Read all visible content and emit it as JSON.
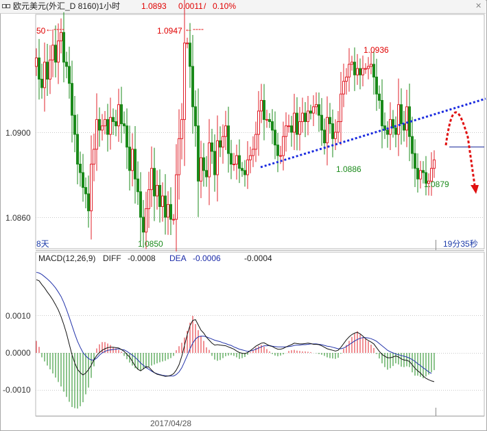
{
  "header": {
    "title": "欧元美元(外汇_D 8160)1小时",
    "price": "1.0893",
    "change": "0.0011",
    "change_sep": "/",
    "change_pct": "0.10%"
  },
  "price_panel": {
    "y_ticks": [
      "1.0900",
      "1.0860"
    ],
    "left_tag": "8天",
    "right_tag": "19分35秒",
    "annotations": {
      "cut_high": "50",
      "high1": "1.0947",
      "high2": "1.0936",
      "low1": "1.0850",
      "low2": "1.0886",
      "low3": "1.0879"
    }
  },
  "macd_panel": {
    "name": "MACD(12,26,9)",
    "diff_label": "DIFF",
    "diff_value": "-0.0008",
    "dea_label": "DEA",
    "dea_value": "-0.0006",
    "macd_value": "-0.0004",
    "y_ticks": [
      "0.0010",
      "0.0000",
      "-0.0010"
    ]
  },
  "x_axis": {
    "date_label": "2017/04/28"
  },
  "colors": {
    "up": "#e0202a",
    "down": "#1a8a1a",
    "diff_line": "#111111",
    "dea_line": "#2233aa",
    "trend_line": "#1a2adf",
    "forecast_arrow": "#e01010"
  },
  "chart_data": [
    {
      "type": "candlestick",
      "title": "欧元美元(外汇_D 8160)1小时",
      "y_ticks": [
        1.09,
        1.086
      ],
      "ylim": [
        1.0842,
        1.0966
      ],
      "key_levels": [
        {
          "label": "1.0947",
          "value": 1.0947
        },
        {
          "label": "1.0936",
          "value": 1.0936
        },
        {
          "label": "1.0850",
          "value": 1.085
        },
        {
          "label": "1.0886",
          "value": 1.0886
        },
        {
          "label": "1.0879",
          "value": 1.0879
        }
      ],
      "series": {
        "close": [
          1.0935,
          1.0925,
          1.0921,
          1.0933,
          1.0925,
          1.0934,
          1.0941,
          1.0933,
          1.0943,
          1.0947,
          1.0933,
          1.0931,
          1.0923,
          1.0908,
          1.0899,
          1.0885,
          1.0881,
          1.0874,
          1.0871,
          1.0863,
          1.0885,
          1.0892,
          1.0906,
          1.0901,
          1.0903,
          1.0906,
          1.0899,
          1.0907,
          1.0905,
          1.0903,
          1.0913,
          1.0904,
          1.0903,
          1.0893,
          1.0882,
          1.0892,
          1.0878,
          1.0872,
          1.086,
          1.0853,
          1.0864,
          1.0873,
          1.0883,
          1.087,
          1.0875,
          1.0865,
          1.087,
          1.086,
          1.0866,
          1.0859,
          1.0859,
          1.088,
          1.0897,
          1.0906,
          1.0942,
          1.0942,
          1.0931,
          1.0912,
          1.0903,
          1.0877,
          1.0888,
          1.0882,
          1.0879,
          1.0895,
          1.0891,
          1.088,
          1.0896,
          1.0893,
          1.0898,
          1.0903,
          1.089,
          1.0885,
          1.0885,
          1.0889,
          1.0883,
          1.0882,
          1.088,
          1.0887,
          1.0889,
          1.0892,
          1.0899,
          1.091,
          1.0915,
          1.0906,
          1.0906,
          1.0905,
          1.0901,
          1.0894,
          1.0889,
          1.0889,
          1.0898,
          1.0903,
          1.0903,
          1.09,
          1.0909,
          1.0899,
          1.0905,
          1.0909,
          1.0905,
          1.091,
          1.0909,
          1.0912,
          1.0913,
          1.0908,
          1.0901,
          1.0895,
          1.0907,
          1.0904,
          1.0897,
          1.09,
          1.0905,
          1.0918,
          1.0924,
          1.0926,
          1.0932,
          1.0933,
          1.0927,
          1.093,
          1.0927,
          1.093,
          1.093,
          1.0931,
          1.0932,
          1.0926,
          1.0918,
          1.0915,
          1.0903,
          1.0901,
          1.0899,
          1.0906,
          1.0902,
          1.0899,
          1.0913,
          1.0904,
          1.0901,
          1.0912,
          1.0898,
          1.089,
          1.0883,
          1.0878,
          1.0882,
          1.0881,
          1.0876,
          1.0877,
          1.0883,
          1.0887
        ]
      }
    },
    {
      "type": "bar",
      "title": "MACD(12,26,9)",
      "y_ticks": [
        0.001,
        0.0,
        -0.001
      ],
      "ylim": [
        -0.0016,
        0.0024
      ],
      "series": [
        {
          "name": "DIFF",
          "values": [
            0.00196,
            0.00193,
            0.00183,
            0.00174,
            0.00163,
            0.00153,
            0.00142,
            0.00129,
            0.00115,
            0.00097,
            0.00076,
            0.00052,
            0.00023,
            -5e-05,
            -0.00027,
            -0.00044,
            -0.00053,
            -0.00059,
            -0.00054,
            -0.00045,
            -0.00033,
            -0.00018,
            -7e-05,
            1e-05,
            7e-05,
            0.00011,
            0.00014,
            0.00015,
            0.00015,
            0.00014,
            0.00013,
            9e-05,
            4e-05,
            -4e-05,
            -0.00011,
            -0.00023,
            -0.00035,
            -0.00044,
            -0.00048,
            -0.00043,
            -0.00037,
            -0.00038,
            -0.00046,
            -0.00053,
            -0.00057,
            -0.00059,
            -0.00061,
            -0.00063,
            -0.00062,
            -0.0006,
            -0.00056,
            -0.00046,
            -0.00032,
            -9e-05,
            0.0002,
            0.00049,
            0.00073,
            0.00087,
            0.00089,
            0.00075,
            0.00061,
            0.00053,
            0.00042,
            0.00034,
            0.00026,
            0.00021,
            0.00022,
            0.00021,
            0.0002,
            0.00019,
            0.00016,
            0.00013,
            0.0001,
            5e-05,
            1e-05,
            -1e-05,
            -2e-05,
            1e-05,
            6e-05,
            0.00012,
            0.00018,
            0.00022,
            0.00026,
            0.00027,
            0.00023,
            0.00019,
            0.00017,
            0.00013,
            0.0001,
            0.0001,
            0.00012,
            0.00016,
            0.00019,
            0.00022,
            0.00026,
            0.00025,
            0.00024,
            0.00024,
            0.00025,
            0.00026,
            0.00025,
            0.00023,
            0.00023,
            0.00022,
            0.00019,
            0.00015,
            0.00011,
            9e-05,
            7e-05,
            5e-05,
            7e-05,
            0.00015,
            0.00025,
            0.00035,
            0.00043,
            0.00049,
            0.00053,
            0.00055,
            0.00051,
            0.00045,
            0.00038,
            0.00033,
            0.00029,
            0.00024,
            0.00014,
            4e-05,
            -4e-05,
            -9e-05,
            -0.00013,
            -0.00013,
            -0.00011,
            -8e-05,
            -0.00011,
            -0.00016,
            -0.00019,
            -0.0002,
            -0.00023,
            -0.00032,
            -0.00041,
            -0.00048,
            -0.00054,
            -0.00062,
            -0.00068,
            -0.00072,
            -0.00075,
            -0.00077
          ]
        },
        {
          "name": "DEA",
          "values": [
            0.00216,
            0.00214,
            0.0021,
            0.00204,
            0.00198,
            0.00191,
            0.00183,
            0.00174,
            0.00163,
            0.00151,
            0.00135,
            0.00116,
            0.00095,
            0.00073,
            0.00051,
            0.00031,
            0.00015,
            1e-05,
            -8e-05,
            -0.00015,
            -0.00019,
            -0.00019,
            -0.00014,
            -6e-05,
            0.0,
            4e-05,
            7e-05,
            8e-05,
            9e-05,
            0.0001,
            0.00011,
            9e-05,
            8e-05,
            4e-05,
            -1e-05,
            -6e-05,
            -0.00012,
            -0.00019,
            -0.00027,
            -0.00033,
            -0.00039,
            -0.00044,
            -0.00049,
            -0.00053,
            -0.00056,
            -0.00058,
            -0.0006,
            -0.00061,
            -0.00062,
            -0.00062,
            -0.00062,
            -0.00058,
            -0.00051,
            -0.0004,
            -0.00024,
            -7e-05,
            0.00011,
            0.00026,
            0.00037,
            0.00043,
            0.00045,
            0.00045,
            0.00043,
            0.0004,
            0.00037,
            0.00034,
            0.00032,
            0.0003,
            0.00027,
            0.00025,
            0.00022,
            0.0002,
            0.00016,
            0.00013,
            0.0001,
            8e-05,
            6e-05,
            4e-05,
            5e-05,
            7e-05,
            0.0001,
            0.00013,
            0.00016,
            0.00019,
            0.00019,
            0.0002,
            0.00018,
            0.00017,
            0.00016,
            0.00016,
            0.00016,
            0.00016,
            0.00017,
            0.00018,
            0.0002,
            0.00021,
            0.00021,
            0.00022,
            0.00022,
            0.00023,
            0.00024,
            0.00024,
            0.00024,
            0.00023,
            0.00022,
            0.0002,
            0.00018,
            0.00017,
            0.00015,
            0.00013,
            0.00011,
            0.00011,
            0.00013,
            0.00017,
            0.00022,
            0.00027,
            0.00032,
            0.00036,
            0.00039,
            0.00041,
            0.00041,
            0.0004,
            0.00038,
            0.00035,
            0.00031,
            0.00025,
            0.00019,
            0.00013,
            7e-05,
            3e-05,
            0.0,
            -3e-05,
            -5e-05,
            -7e-05,
            -9e-05,
            -0.00011,
            -0.00014,
            -0.00018,
            -0.00023,
            -0.00029,
            -0.00034,
            -0.0004,
            -0.00045,
            -0.00051,
            -0.00055
          ]
        },
        {
          "name": "MACD",
          "values": [
            0.00032,
            0.00016,
            -0.00012,
            -0.00023,
            -0.00034,
            -0.00044,
            -0.00055,
            -0.00066,
            -0.00078,
            -0.0009,
            -0.00104,
            -0.00118,
            -0.00131,
            -0.00145,
            -0.00148,
            -0.00149,
            -0.00143,
            -0.00132,
            -0.00111,
            -0.00093,
            -0.00067,
            -0.00036,
            0.00012,
            0.00023,
            0.00029,
            0.00029,
            0.00025,
            0.00021,
            0.00015,
            0.00012,
            8e-05,
            3e-05,
            -8e-05,
            -0.00017,
            -0.00026,
            -0.00034,
            -0.00041,
            -0.00045,
            -0.00047,
            -0.00044,
            -0.00041,
            -0.00037,
            -0.00034,
            -0.00031,
            -0.00028,
            -0.00025,
            -0.00023,
            -0.00021,
            -0.00017,
            -0.00014,
            -8e-05,
            7e-05,
            0.00018,
            0.00027,
            0.00041,
            0.00059,
            0.00081,
            0.00099,
            0.00077,
            0.00061,
            0.00045,
            0.00032,
            0.00015,
            8e-05,
            -8e-05,
            -0.00018,
            -0.00021,
            -0.00019,
            -0.00014,
            -9e-05,
            -7e-05,
            -6e-05,
            -8e-05,
            -0.00012,
            -0.00016,
            -0.00014,
            -0.00011,
            -5e-05,
            2e-05,
            8e-05,
            0.00014,
            0.00018,
            0.00021,
            0.00017,
            0.0001,
            4e-05,
            -3e-05,
            -7e-05,
            -9e-05,
            -7e-05,
            -4e-05,
            0.0,
            5e-05,
            7e-05,
            8e-05,
            6e-05,
            5e-05,
            4e-05,
            4e-05,
            3e-05,
            2e-05,
            0.0,
            -1e-05,
            -3e-05,
            -5e-05,
            -8e-05,
            -0.00012,
            -0.00014,
            -0.00015,
            -0.00016,
            -0.00013,
            -2e-05,
            0.00011,
            0.00021,
            0.00032,
            0.00043,
            0.00052,
            0.00058,
            0.00049,
            0.00042,
            0.00037,
            0.00031,
            0.00022,
            0.00013,
            -3e-05,
            -0.00015,
            -0.00028,
            -0.00038,
            -0.00045,
            -0.00041,
            -0.00035,
            -0.00028,
            -0.00031,
            -0.00037,
            -0.00038,
            -0.00036,
            -0.00038,
            -0.00052,
            -0.00061,
            -0.00061,
            -0.00064,
            -0.00068,
            -0.00063,
            -0.00058,
            -0.00052,
            -0.00046
          ]
        }
      ]
    }
  ]
}
